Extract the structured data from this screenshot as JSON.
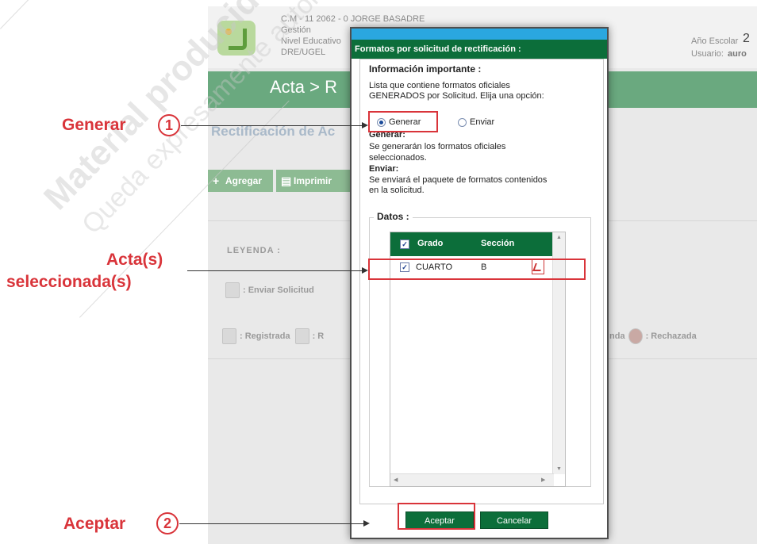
{
  "app": {
    "header_line1": "C.M - 11 2062 - 0 JORGE BASADRE",
    "header_line2": "Gestión",
    "header_line3": "Nivel Educativo",
    "header_line4": "DRE/UGEL",
    "year_label": "Año Escolar",
    "year_value": "2",
    "user_label": "Usuario:",
    "user_value": "auro",
    "breadcrumb": "Acta > R",
    "section_title": "Rectificación de Ac",
    "btn_add": "Agregar",
    "btn_print": "Imprimir",
    "legend_label": "LEYENDA :",
    "legend_send": ": Enviar Solicitud",
    "legend_registered": ": Registrada",
    "legend_r": ": R",
    "legend_nda": "nda",
    "legend_rejected": ": Rechazada"
  },
  "watermark": {
    "line1": "Material producido",
    "line2": "Queda expresamente autoriza"
  },
  "dialog": {
    "title": "Formatos por solicitud de rectificación :",
    "important_heading": "Información importante :",
    "intro_line1": "Lista que contiene formatos oficiales",
    "intro_line2": "GENERADOS por Solicitud. Elija una opción:",
    "radio_generate": "Generar",
    "radio_send": "Enviar",
    "selected_option": "Generar",
    "gen_heading": "Generar:",
    "gen_text1": "Se generarán los formatos oficiales",
    "gen_text2": "seleccionados.",
    "send_heading": "Enviar:",
    "send_text1": "Se enviará el paquete de formatos contenidos",
    "send_text2": "en la solicitud.",
    "datos_label": "Datos :",
    "grid": {
      "columns": [
        "Grado",
        "Sección"
      ],
      "header_checked": true,
      "rows": [
        {
          "checked": true,
          "grado": "CUARTO",
          "seccion": "B",
          "icon": "pdf-icon"
        }
      ]
    },
    "btn_accept": "Aceptar",
    "btn_cancel": "Cancelar"
  },
  "callouts": {
    "generar": {
      "label": "Generar",
      "number": "1"
    },
    "acta_line1": "Acta(s)",
    "acta_line2": "seleccionada(s)",
    "aceptar": {
      "label": "Aceptar",
      "number": "2"
    }
  },
  "colors": {
    "dialog_header": "#0c6e3a",
    "dialog_topbar": "#2aa7e0",
    "callout_red": "#d9343a",
    "app_bar": "#6aa97f"
  }
}
